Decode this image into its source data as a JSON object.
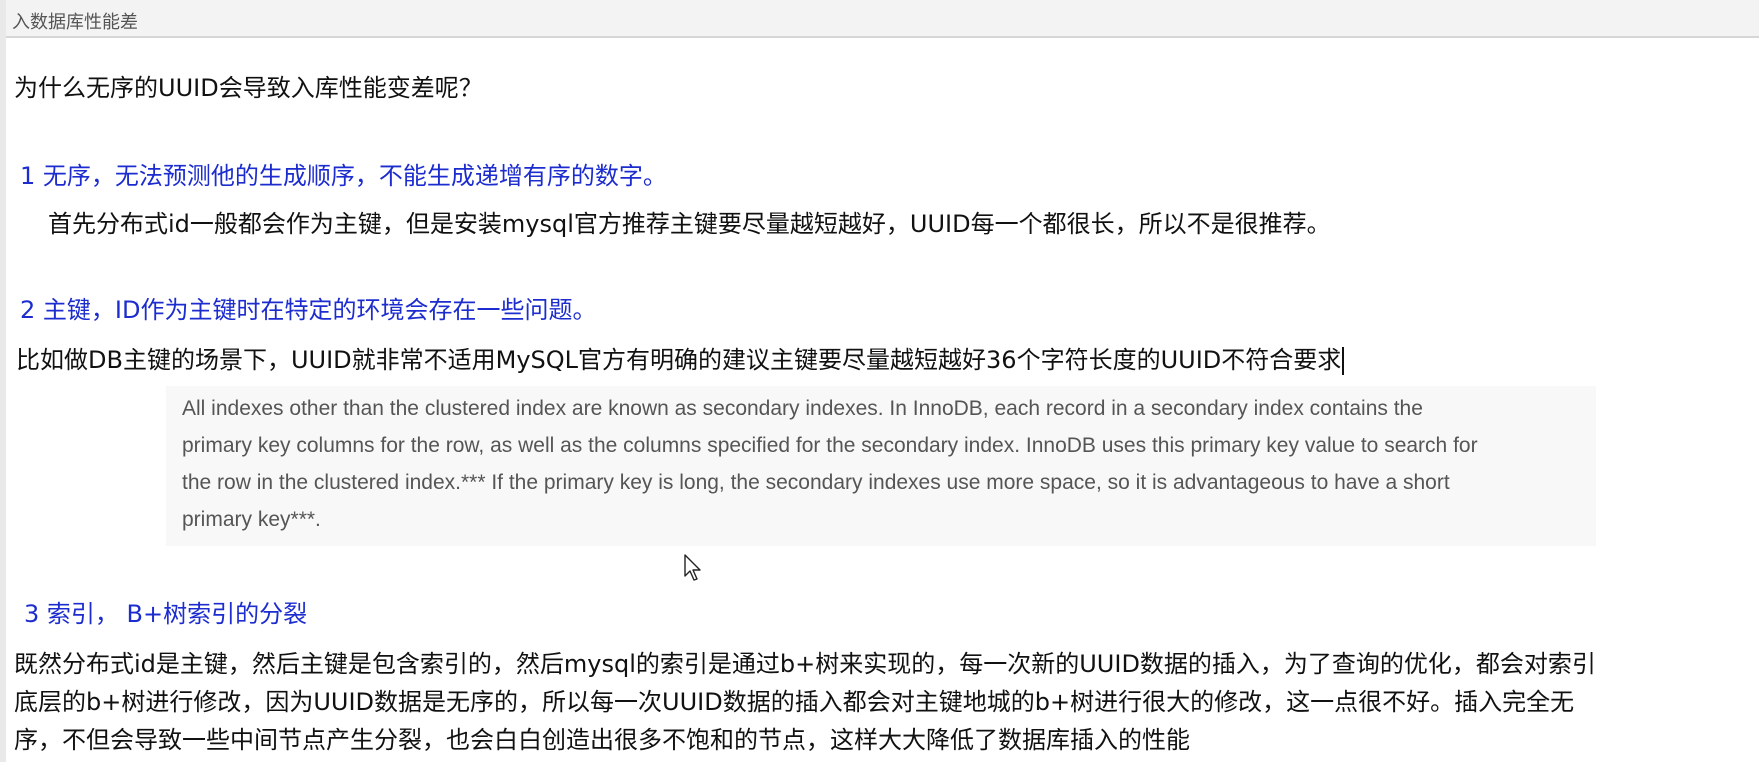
{
  "header": {
    "title": "入数据库性能差"
  },
  "main": {
    "question": "为什么无序的UUID会导致入库性能变差呢？",
    "sections": [
      {
        "heading": "1   无序，无法预测他的生成顺序，不能生成递增有序的数字。",
        "body": "首先分布式id一般都会作为主键，但是安装mysql官方推荐主键要尽量越短越好，UUID每一个都很长，所以不是很推荐。"
      },
      {
        "heading": "2   主键，ID作为主键时在特定的环境会存在一些问题。",
        "body": "比如做DB主键的场景下，UUID就非常不适用MySQL官方有明确的建议主键要尽量越短越好36个字符长度的UUID不符合要求"
      },
      {
        "heading": "3  索引，  B+树索引的分裂",
        "lines": [
          "既然分布式id是主键，然后主键是包含索引的，然后mysql的索引是通过b+树来实现的，每一次新的UUID数据的插入，为了查询的优化，都会对索引",
          "底层的b+树进行修改，因为UUID数据是无序的，所以每一次UUID数据的插入都会对主键地城的b+树进行很大的修改，这一点很不好。插入完全无",
          "序，不但会导致一些中间节点产生分裂，也会白白创造出很多不饱和的节点，这样大大降低了数据库插入的性能"
        ]
      }
    ],
    "quote_lines": [
      "All indexes other than the clustered index are known as secondary indexes. In InnoDB, each record in a secondary index contains the",
      "primary key columns for the row, as well as the columns specified for the secondary index. InnoDB uses this primary key value to search for",
      "the row in the clustered index.*** If the primary key is long, the secondary indexes use more space, so it is advantageous to have a short",
      "primary key***."
    ]
  },
  "colors": {
    "heading": "#1c2ccf",
    "text": "#111111",
    "quote_text": "#555555",
    "quote_bg": "#f8f8f8"
  },
  "icons": {
    "mouse_cursor": "arrow-pointer-icon"
  }
}
